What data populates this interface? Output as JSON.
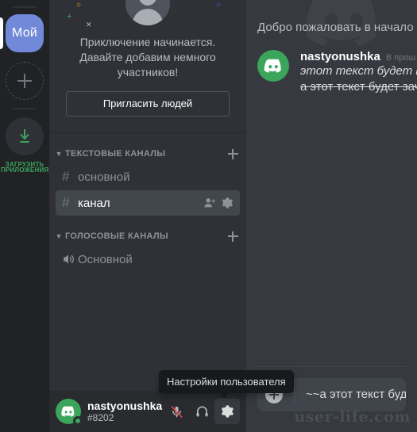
{
  "colors": {
    "rail_bg": "#202225",
    "sidebar_bg": "#2f3136",
    "chat_bg": "#36393f",
    "brand": "#7289da",
    "green": "#3ba55c",
    "active_channel": "#42464d",
    "tooltip_bg": "#18191c"
  },
  "rail": {
    "servers": [
      {
        "label": "Мой",
        "icon": "server-avatar",
        "selected": true
      }
    ],
    "add_server_label": "+",
    "download": {
      "icon": "download-arrow-icon",
      "label_line1": "ЗАГРУЗИТЬ",
      "label_line2": "ПРИЛОЖЕНИЯ"
    }
  },
  "sidebar": {
    "welcome": {
      "line1": "Приключение начинается.",
      "line2": "Давайте добавим немного",
      "line3": "участников!",
      "invite_button": "Пригласить людей"
    },
    "groups": [
      {
        "title": "ТЕКСТОВЫЕ КАНАЛЫ",
        "add_label": "+",
        "channels": [
          {
            "name": "основной",
            "type": "text",
            "active": false
          },
          {
            "name": "канал",
            "type": "text",
            "active": true,
            "actions": [
              "add-member-icon",
              "settings-gear-icon"
            ]
          }
        ]
      },
      {
        "title": "ГОЛОСОВЫЕ КАНАЛЫ",
        "add_label": "+",
        "channels": [
          {
            "name": "Основной",
            "type": "voice",
            "active": false
          }
        ]
      }
    ]
  },
  "user_panel": {
    "username": "nastyonushka",
    "discriminator": "#8202",
    "status": "online",
    "buttons": [
      {
        "name": "mute-microphone-button",
        "icon": "microphone-muted-icon",
        "muted": true
      },
      {
        "name": "deafen-button",
        "icon": "headphones-icon",
        "muted": false
      },
      {
        "name": "user-settings-button",
        "icon": "settings-gear-icon",
        "active": true
      }
    ]
  },
  "tooltip": {
    "text": "Настройки пользователя"
  },
  "chat": {
    "welcome_heading": "Добро пожаловать в начало",
    "message": {
      "author": "nastyonushka",
      "timestamp": "В прош",
      "lines": [
        {
          "text": "этот текст будет выд",
          "style": "italic"
        },
        {
          "text": "а этот текст будет зач",
          "style": "strike"
        }
      ]
    },
    "composer": {
      "value": "~~а этот текст будет зач",
      "add_icon": "plus-circle-icon"
    }
  },
  "watermark": {
    "site": "user-life.com"
  }
}
